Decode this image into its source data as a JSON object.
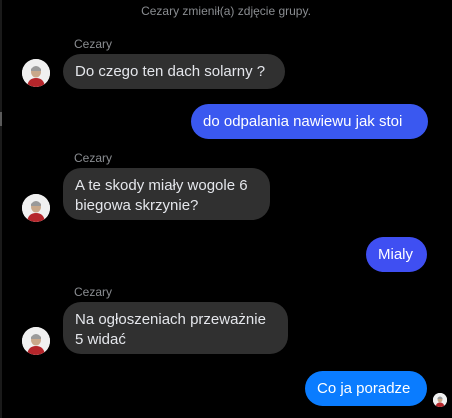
{
  "system": {
    "group_photo_changed": "Cezary zmienił(a) zdjęcie grupy."
  },
  "messages": [
    {
      "sender": "Cezary",
      "text": "Do czego ten dach solarny ?"
    },
    {
      "text": "do odpalania nawiewu jak stoi"
    },
    {
      "sender": "Cezary",
      "text": "A te skody miały wogole 6 biegowa skrzynie?"
    },
    {
      "text": "Mialy"
    },
    {
      "sender": "Cezary",
      "text": "Na ogłoszeniach przeważnie 5 widać"
    },
    {
      "text": "Co ja poradze"
    }
  ],
  "icons": {
    "avatar": "user-avatar-icon",
    "read_receipt": "read-receipt-avatar-icon"
  },
  "colors": {
    "background": "#000000",
    "incoming_bubble": "#303030",
    "outgoing_bubble_top": "#3a58f0",
    "outgoing_bubble_bottom": "#0a7cff",
    "meta_text": "#8a8d91"
  }
}
